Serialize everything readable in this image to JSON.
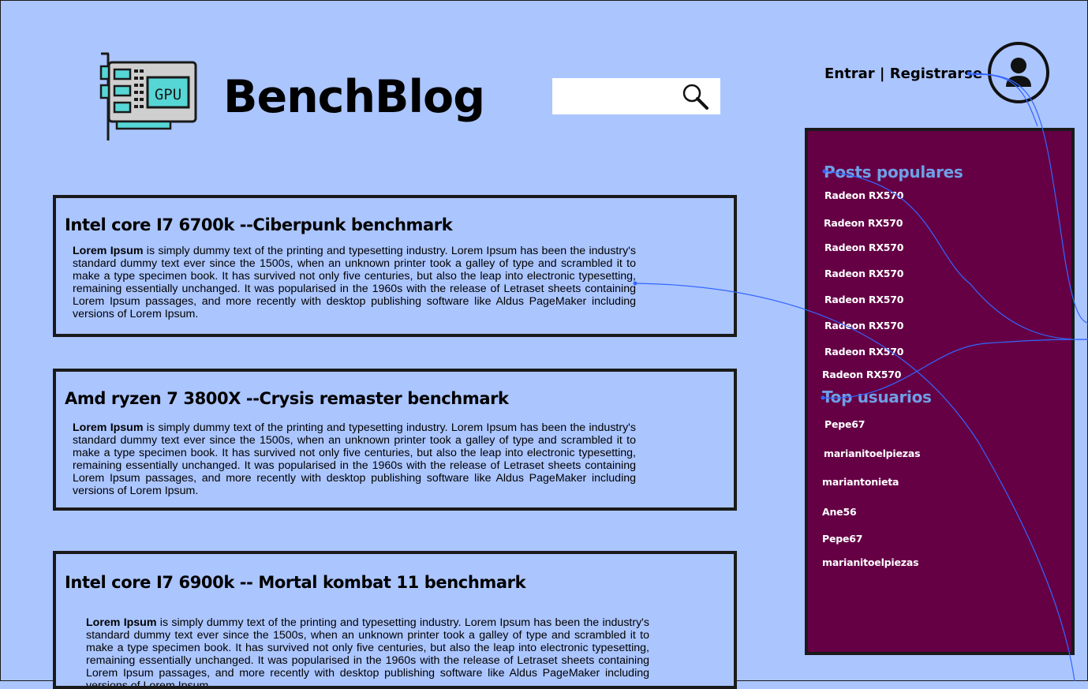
{
  "header": {
    "brand": "BenchBlog",
    "logo_text": "GPU",
    "search_placeholder": "",
    "auth": {
      "login": "Entrar",
      "separator": "|",
      "register": "Registrarse"
    }
  },
  "posts": [
    {
      "title": "Intel core I7 6700k --Ciberpunk benchmark",
      "lead": "Lorem Ipsum",
      "body": " is simply dummy text of the printing and typesetting industry. Lorem Ipsum has been the industry's standard dummy text ever since the 1500s, when an unknown printer took a galley of type and scrambled it to make a type specimen book. It has survived not only five centuries, but also the leap into electronic typesetting, remaining essentially unchanged. It was popularised in the 1960s with the release of Letraset sheets containing Lorem Ipsum passages, and more recently with desktop publishing software like Aldus PageMaker including versions of Lorem Ipsum."
    },
    {
      "title": "Amd ryzen 7 3800X --Crysis remaster benchmark",
      "lead": "Lorem Ipsum",
      "body": " is simply dummy text of the printing and typesetting industry. Lorem Ipsum has been the industry's standard dummy text ever since the 1500s, when an unknown printer took a galley of type and scrambled it to make a type specimen book. It has survived not only five centuries, but also the leap into electronic typesetting, remaining essentially unchanged. It was popularised in the 1960s with the release of Letraset sheets containing Lorem Ipsum passages, and more recently with desktop publishing software like Aldus PageMaker including versions of Lorem Ipsum."
    },
    {
      "title": "Intel core I7 6900k -- Mortal kombat 11 benchmark",
      "lead": "Lorem Ipsum",
      "body": " is simply dummy text of the printing and typesetting industry. Lorem Ipsum has been the industry's standard dummy text ever since the 1500s, when an unknown printer took a galley of type and scrambled it to make a type specimen book. It has survived not only five centuries, but also the leap into electronic typesetting, remaining essentially unchanged. It was popularised in the 1960s with the release of Letraset sheets containing Lorem Ipsum passages, and more recently with desktop publishing software like Aldus PageMaker including versions of Lorem Ipsum."
    }
  ],
  "sidebar": {
    "popular_title": "Posts populares",
    "popular": [
      "Radeon RX570",
      "Radeon RX570",
      "Radeon RX570",
      "Radeon RX570",
      "Radeon RX570",
      "Radeon RX570",
      "Radeon RX570",
      "Radeon RX570"
    ],
    "users_title": "Top usuarios",
    "users": [
      "Pepe67",
      "marianitoelpiezas",
      "mariantonieta",
      "Ane56",
      "Pepe67",
      "marianitoelpiezas"
    ]
  },
  "colors": {
    "background": "#abc5ff",
    "sidebar": "#650045",
    "sidebar_heading": "#6f9fe6",
    "wire": "#3366ff"
  },
  "icons": {
    "logo": "gpu-card-icon",
    "search": "magnifier-icon",
    "avatar": "user-avatar-icon"
  }
}
